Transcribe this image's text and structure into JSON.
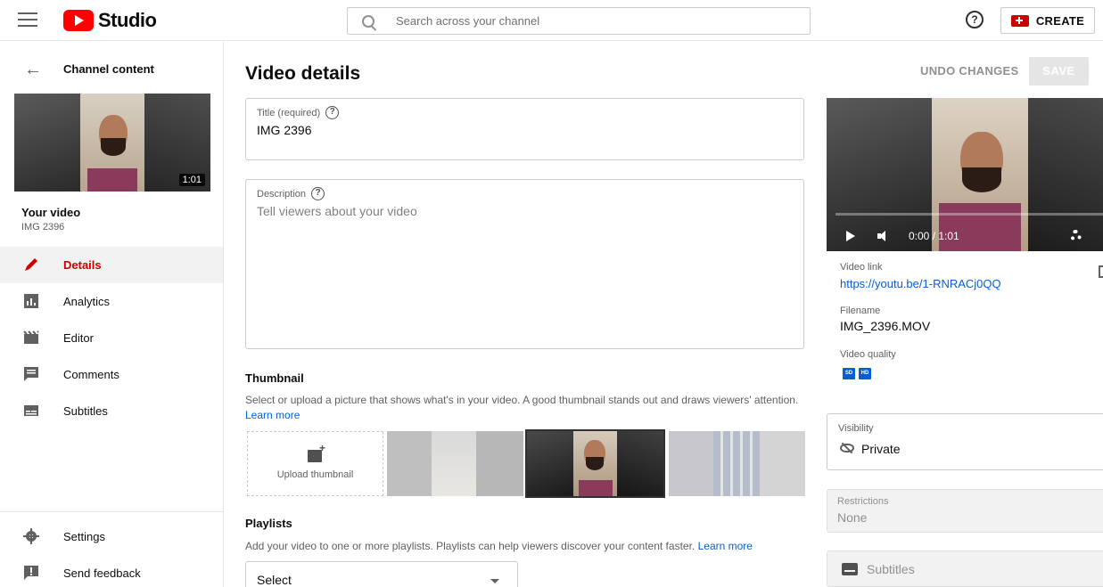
{
  "header": {
    "logo_text": "Studio",
    "search_placeholder": "Search across your channel",
    "help_glyph": "?",
    "create_label": "CREATE"
  },
  "sidebar": {
    "back_label": "Channel content",
    "thumbnail_duration": "1:01",
    "your_video_heading": "Your video",
    "your_video_title": "IMG 2396",
    "items": [
      {
        "label": "Details",
        "icon": "pencil-icon",
        "active": true
      },
      {
        "label": "Analytics",
        "icon": "analytics-icon"
      },
      {
        "label": "Editor",
        "icon": "clapperboard-icon"
      },
      {
        "label": "Comments",
        "icon": "comment-icon"
      },
      {
        "label": "Subtitles",
        "icon": "subtitles-icon"
      }
    ],
    "bottom_items": [
      {
        "label": "Settings",
        "icon": "gear-icon"
      },
      {
        "label": "Send feedback",
        "icon": "feedback-icon"
      }
    ]
  },
  "main": {
    "page_title": "Video details",
    "undo_label": "UNDO CHANGES",
    "save_label": "SAVE",
    "title_field": {
      "label": "Title (required)",
      "value": "IMG 2396"
    },
    "description_field": {
      "label": "Description",
      "placeholder": "Tell viewers about your video"
    },
    "thumbnail": {
      "heading": "Thumbnail",
      "description": "Select or upload a picture that shows what's in your video. A good thumbnail stands out and draws viewers' attention.",
      "learn_more": "Learn more",
      "upload_label": "Upload thumbnail"
    },
    "playlists": {
      "heading": "Playlists",
      "description": "Add your video to one or more playlists. Playlists can help viewers discover your content faster.",
      "learn_more": "Learn more",
      "select_label": "Select"
    }
  },
  "right_panel": {
    "player_time": "0:00 / 1:01",
    "video_link_label": "Video link",
    "video_link": "https://youtu.be/1-RNRACj0QQ",
    "filename_label": "Filename",
    "filename": "IMG_2396.MOV",
    "quality_label": "Video quality",
    "quality_badges": [
      "SD",
      "HD"
    ],
    "visibility_label": "Visibility",
    "visibility_value": "Private",
    "restrictions_label": "Restrictions",
    "restrictions_value": "None",
    "subtitles_label": "Subtitles"
  },
  "colors": {
    "brand_red": "#ff0000",
    "active_red": "#cc0000",
    "link_blue": "#065fd4"
  }
}
